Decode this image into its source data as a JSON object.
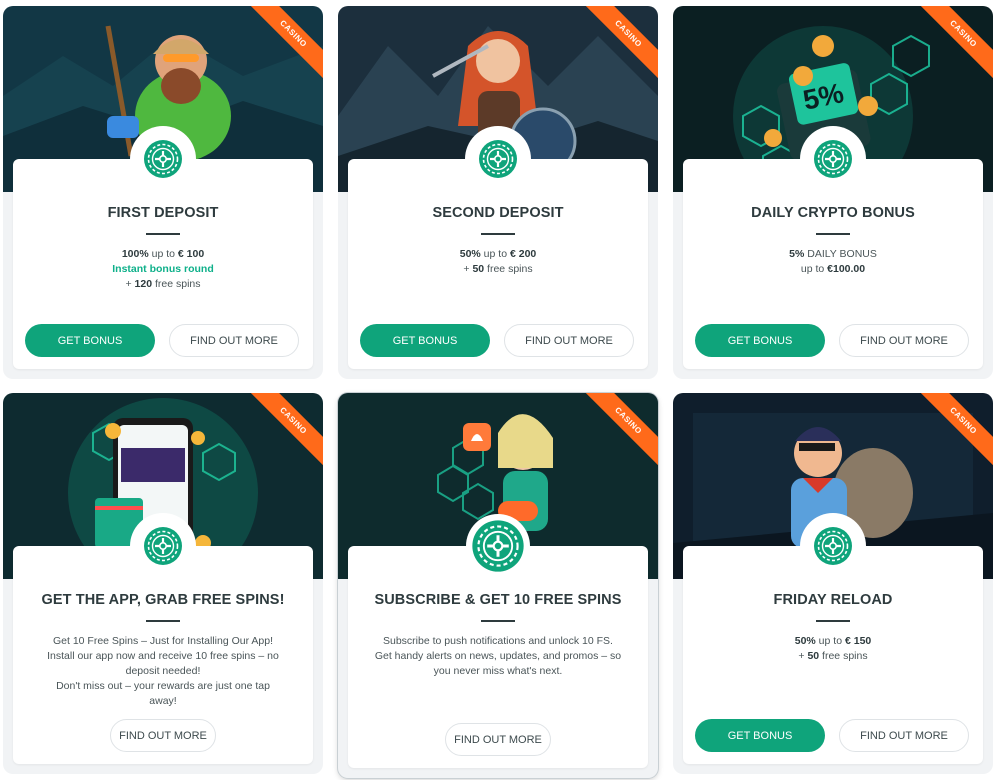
{
  "badge": "CASINO",
  "cards": [
    {
      "title": "FIRST DEPOSIT",
      "line1_bold": "100%",
      "line1_rest": " up to ",
      "line1_amount": "€ 100",
      "line2_green": "Instant bonus round",
      "line3_plus": "+ ",
      "line3_bold": "120",
      "line3_rest": " free spins",
      "primary": "GET BONUS",
      "secondary": "FIND OUT MORE"
    },
    {
      "title": "SECOND DEPOSIT",
      "line1_bold": "50%",
      "line1_rest": " up to ",
      "line1_amount": "€ 200",
      "line2_plus": "+ ",
      "line2_bold": "50",
      "line2_rest": " free spins",
      "primary": "GET BONUS",
      "secondary": "FIND OUT MORE"
    },
    {
      "title": "DAILY CRYPTO BONUS",
      "line1_bold": "5%",
      "line1_rest": " DAILY BONUS",
      "line2_rest": "up to ",
      "line2_bold": "€100.00",
      "primary": "GET BONUS",
      "secondary": "FIND OUT MORE"
    },
    {
      "title": "GET THE APP, GRAB FREE SPINS!",
      "lines": [
        "Get 10 Free Spins – Just for Installing Our App!",
        "Install our app now and receive 10 free spins – no deposit needed!",
        "Don't miss out – your rewards are just one tap away!"
      ],
      "secondary": "FIND OUT MORE"
    },
    {
      "title": "SUBSCRIBE & GET 10 FREE SPINS",
      "text": "Subscribe to push notifications and unlock 10 FS. Get handy alerts on news, updates, and promos – so you never miss what's next.",
      "secondary": "FIND OUT MORE"
    },
    {
      "title": "FRIDAY RELOAD",
      "line1_bold": "50%",
      "line1_rest": " up to ",
      "line1_amount": "€ 150",
      "line2_plus": "+ ",
      "line2_bold": "50",
      "line2_rest": " free spins",
      "primary": "GET BONUS",
      "secondary": "FIND OUT MORE"
    }
  ],
  "colors": {
    "accent": "#0fa47b",
    "ribbon": "#ff6a1a",
    "title": "#2e3b3e"
  }
}
